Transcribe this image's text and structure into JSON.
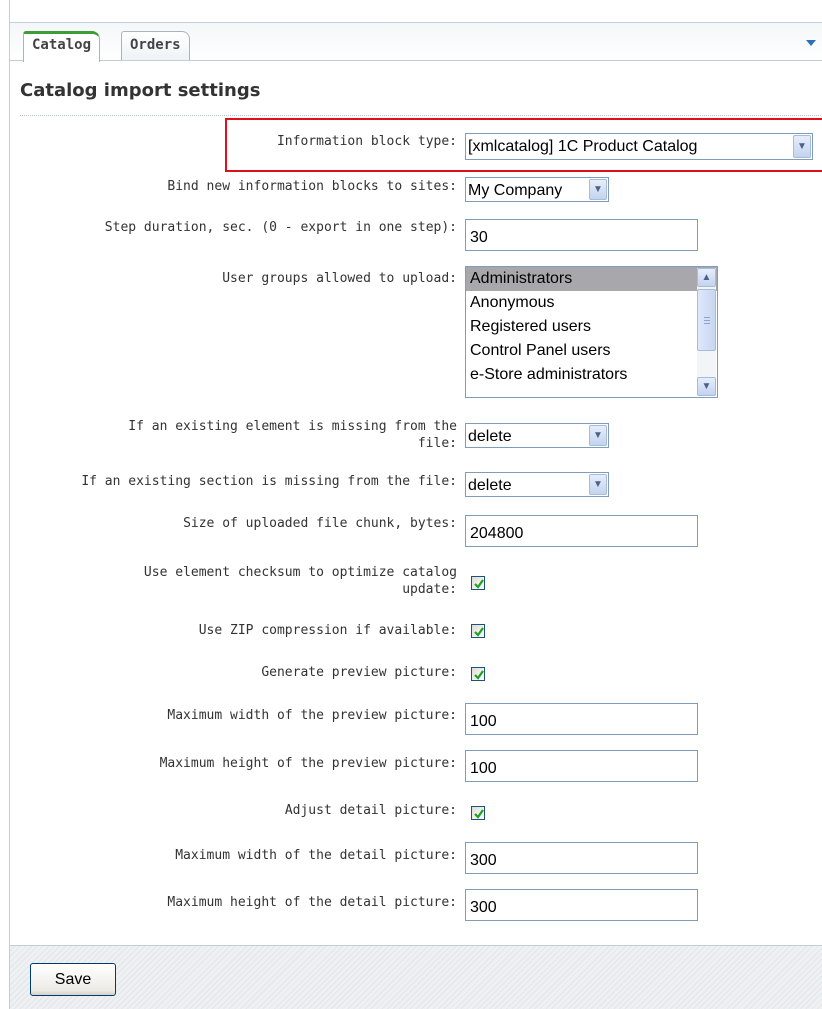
{
  "tabs": [
    {
      "label": "Catalog",
      "active": true
    },
    {
      "label": "Orders",
      "active": false
    }
  ],
  "title": "Catalog import settings",
  "fields": {
    "iblock_type": {
      "label": "Information block type:",
      "value": "[xmlcatalog] 1C Product Catalog"
    },
    "bind_sites": {
      "label": "Bind new information blocks to sites:",
      "value": "My Company"
    },
    "step_duration": {
      "label": "Step duration, sec. (0 - export in one step):",
      "value": "30"
    },
    "user_groups": {
      "label": "User groups allowed to upload:",
      "options": [
        "Administrators",
        "Anonymous",
        "Registered users",
        "Control Panel users",
        "e-Store administrators"
      ],
      "selected": "Administrators"
    },
    "element_missing": {
      "label_line1": "If an existing element is missing from the",
      "label_line2": "file:",
      "value": "delete"
    },
    "section_missing": {
      "label": "If an existing section is missing from the file:",
      "value": "delete"
    },
    "chunk_size": {
      "label": "Size of uploaded file chunk, bytes:",
      "value": "204800"
    },
    "use_checksum": {
      "label_line1": "Use element checksum to optimize catalog",
      "label_line2": "update:",
      "checked": true
    },
    "use_zip": {
      "label": "Use ZIP compression if available:",
      "checked": true
    },
    "gen_preview": {
      "label": "Generate preview picture:",
      "checked": true
    },
    "preview_width": {
      "label": "Maximum width of the preview picture:",
      "value": "100"
    },
    "preview_height": {
      "label": "Maximum height of the preview picture:",
      "value": "100"
    },
    "adjust_detail": {
      "label": "Adjust detail picture:",
      "checked": true
    },
    "detail_width": {
      "label": "Maximum width of the detail picture:",
      "value": "300"
    },
    "detail_height": {
      "label": "Maximum height of the detail picture:",
      "value": "300"
    }
  },
  "save_label": "Save",
  "colors": {
    "active_tab_accent": "#3d9d39",
    "highlight_border": "#e0101a",
    "checkmark": "#21a121"
  }
}
